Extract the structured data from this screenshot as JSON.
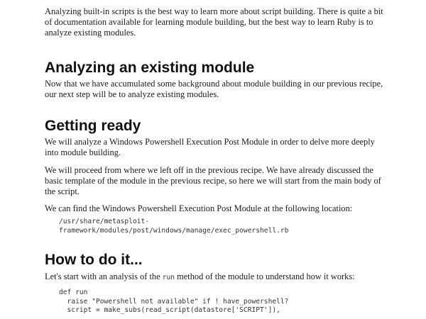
{
  "intro": {
    "paragraph": "Analyzing built-in scripts is the best way to learn more about script building. There is quite a bit of documentation available for learning module building, but the best way to learn Ruby is to analyze existing modules."
  },
  "section_analyzing": {
    "heading": "Analyzing an existing module",
    "paragraph": "Now that we have accumulated some background about module building in our previous recipe, our next step will be to analyze existing modules."
  },
  "section_getting_ready": {
    "heading": "Getting ready",
    "paragraph1": "We will analyze a Windows Powershell Execution Post Module in order to delve more deeply into module building.",
    "paragraph2": "We will proceed from where we left off in the previous recipe. We have already discussed the basic template of the module in the previous recipe, so here we will start from the main body of the script.",
    "paragraph3": "We can find the Windows Powershell Execution Post Module at the following location:",
    "path_line1": "/usr/share/metasploit-",
    "path_line2": "framework/modules/post/windows/manage/exec_powershell.rb"
  },
  "section_how_to": {
    "heading": "How to do it...",
    "paragraph_before": "Let's start with an analysis of the ",
    "inline_code": "run",
    "paragraph_after": " method of the module to understand how it works:",
    "code_lines": [
      "def run",
      "  raise \"Powershell not available\" if ! have_powershell?",
      "  script = make_subs(read_script(datastore['SCRIPT']),"
    ]
  }
}
